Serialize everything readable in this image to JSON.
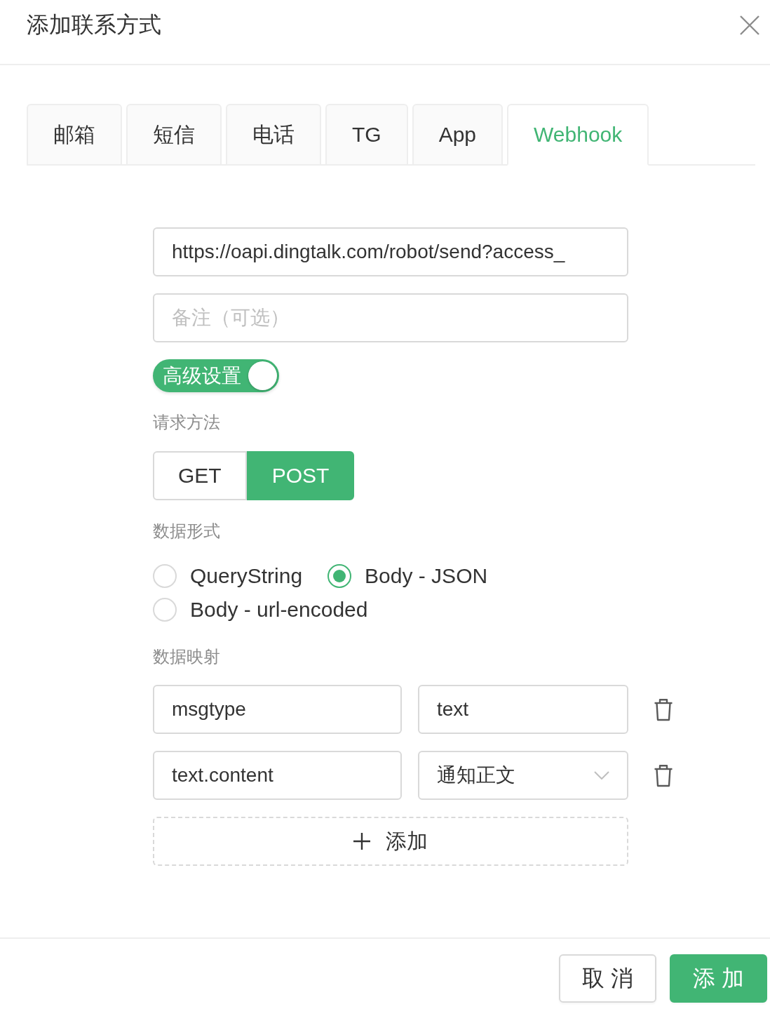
{
  "dialog": {
    "title": "添加联系方式"
  },
  "tabs": [
    {
      "label": "邮箱",
      "selected": false
    },
    {
      "label": "短信",
      "selected": false
    },
    {
      "label": "电话",
      "selected": false
    },
    {
      "label": "TG",
      "selected": false
    },
    {
      "label": "App",
      "selected": false
    },
    {
      "label": "Webhook",
      "selected": true
    }
  ],
  "form": {
    "url_field": {
      "value": "https://oapi.dingtalk.com/robot/send?access_"
    },
    "remark_field": {
      "placeholder": "备注（可选）"
    },
    "advanced_toggle": {
      "label": "高级设置",
      "on": true
    },
    "method": {
      "label": "请求方法",
      "options": [
        {
          "label": "GET",
          "selected": false
        },
        {
          "label": "POST",
          "selected": true
        }
      ]
    },
    "data_format": {
      "label": "数据形式",
      "options": [
        {
          "label": "QueryString",
          "selected": false
        },
        {
          "label": "Body - JSON",
          "selected": true
        },
        {
          "label": "Body - url-encoded",
          "selected": false
        }
      ]
    },
    "data_mapping": {
      "label": "数据映射",
      "rows": [
        {
          "key": "msgtype",
          "value": "text",
          "kind": "input"
        },
        {
          "key": "text.content",
          "value": "通知正文",
          "kind": "select"
        }
      ],
      "add_button": {
        "label": "添加"
      }
    }
  },
  "footer": {
    "buttons": [
      {
        "label": "取 消",
        "kind": "default"
      },
      {
        "label": "添 加",
        "kind": "primary"
      }
    ]
  }
}
